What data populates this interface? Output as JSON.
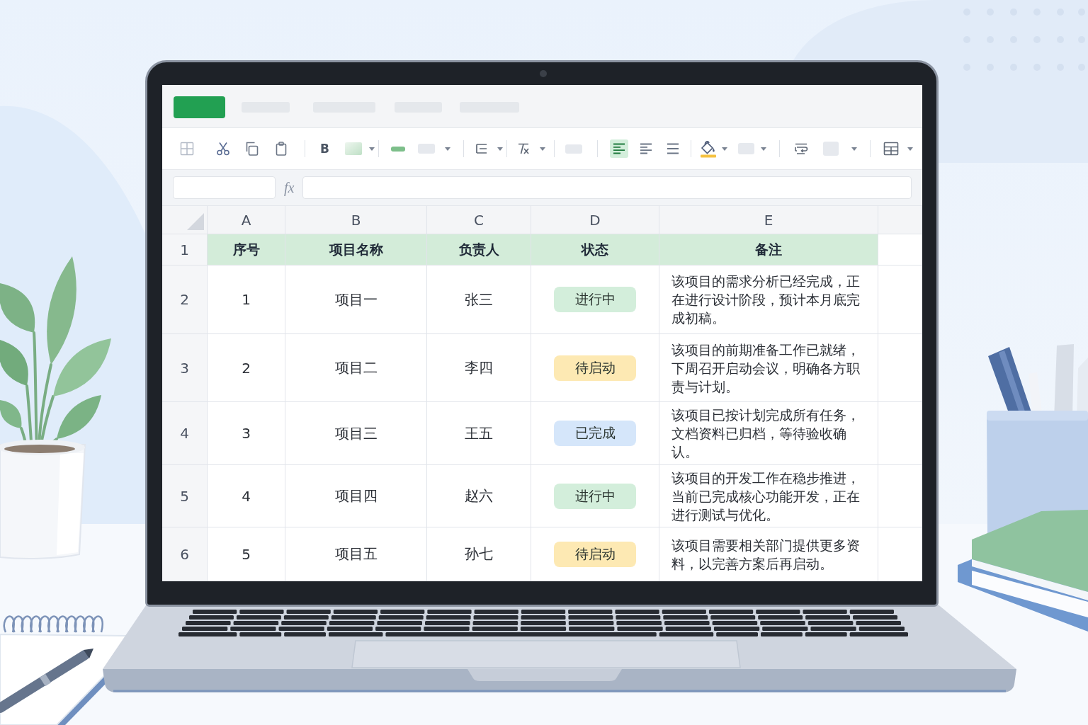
{
  "menu_tabs": [
    {
      "selected": true
    },
    {
      "selected": false
    },
    {
      "selected": false
    },
    {
      "selected": false
    },
    {
      "selected": false
    }
  ],
  "toolbar": {
    "bold_label": "B",
    "alignment": [
      {
        "kind": "left",
        "selected": true
      },
      {
        "kind": "left",
        "selected": false
      },
      {
        "kind": "justify",
        "selected": false
      }
    ]
  },
  "formula_bar": {
    "fx_label": "fx"
  },
  "sheet": {
    "column_letters": [
      "A",
      "B",
      "C",
      "D",
      "E"
    ],
    "row_numbers": [
      "1",
      "2",
      "3",
      "4",
      "5",
      "6"
    ],
    "header_row": [
      "序号",
      "项目名称",
      "负责人",
      "状态",
      "备注"
    ],
    "rows": [
      {
        "number": "1",
        "project": "项目一",
        "owner": "张三",
        "status": {
          "label": "进行中",
          "color": "#d3eedb"
        },
        "note": "该项目的需求分析已经完成，正在进行设计阶段，预计本月底完成初稿。"
      },
      {
        "number": "2",
        "project": "项目二",
        "owner": "李四",
        "status": {
          "label": "待启动",
          "color": "#fde9b3"
        },
        "note": "该项目的前期准备工作已就绪，下周召开启动会议，明确各方职责与计划。"
      },
      {
        "number": "3",
        "project": "项目三",
        "owner": "王五",
        "status": {
          "label": "已完成",
          "color": "#d5e6fa"
        },
        "note": "该项目已按计划完成所有任务，文档资料已归档，等待验收确认。"
      },
      {
        "number": "4",
        "project": "项目四",
        "owner": "赵六",
        "status": {
          "label": "进行中",
          "color": "#d3eedb"
        },
        "note": "该项目的开发工作在稳步推进，当前已完成核心功能开发，正在进行测试与优化。"
      },
      {
        "number": "5",
        "project": "项目五",
        "owner": "孙七",
        "status": {
          "label": "待启动",
          "color": "#fde9b3"
        },
        "note": "该项目需要相关部门提供更多资料，以完善方案后再启动。"
      }
    ]
  }
}
